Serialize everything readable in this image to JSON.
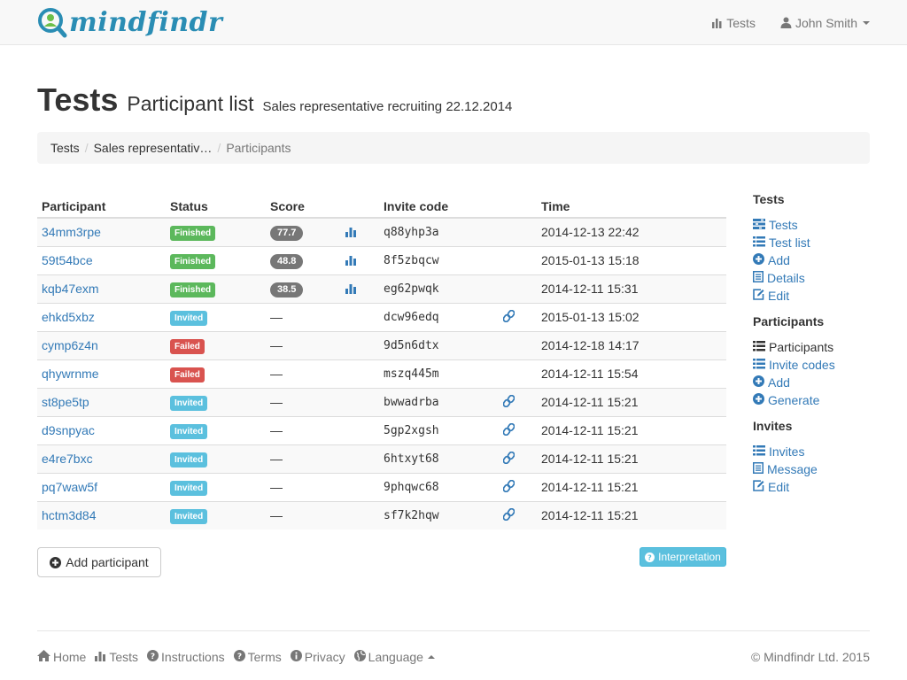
{
  "app": {
    "logo_text": "mindfindr"
  },
  "navbar": {
    "tests_label": "Tests",
    "user_label": "John Smith"
  },
  "header": {
    "title": "Tests",
    "subtitle": "Participant list",
    "context": "Sales representative recruiting 22.12.2014"
  },
  "breadcrumb": {
    "items": [
      "Tests",
      "Sales representativ…",
      "Participants"
    ]
  },
  "table": {
    "headers": [
      "Participant",
      "Status",
      "Score",
      "Invite code",
      "Time"
    ],
    "rows": [
      {
        "participant": "34mm3rpe",
        "status": "Finished",
        "score": "77.7",
        "invite_code": "q88yhp3a",
        "time": "2014-12-13 22:42"
      },
      {
        "participant": "59t54bce",
        "status": "Finished",
        "score": "48.8",
        "invite_code": "8f5zbqcw",
        "time": "2015-01-13 15:18"
      },
      {
        "participant": "kqb47exm",
        "status": "Finished",
        "score": "38.5",
        "invite_code": "eg62pwqk",
        "time": "2014-12-11 15:31"
      },
      {
        "participant": "ehkd5xbz",
        "status": "Invited",
        "score": "—",
        "invite_code": "dcw96edq",
        "time": "2015-01-13 15:02"
      },
      {
        "participant": "cymp6z4n",
        "status": "Failed",
        "score": "—",
        "invite_code": "9d5n6dtx",
        "time": "2014-12-18 14:17"
      },
      {
        "participant": "qhywrnme",
        "status": "Failed",
        "score": "—",
        "invite_code": "mszq445m",
        "time": "2014-12-11 15:54"
      },
      {
        "participant": "st8pe5tp",
        "status": "Invited",
        "score": "—",
        "invite_code": "bwwadrba",
        "time": "2014-12-11 15:21"
      },
      {
        "participant": "d9snpyac",
        "status": "Invited",
        "score": "—",
        "invite_code": "5gp2xgsh",
        "time": "2014-12-11 15:21"
      },
      {
        "participant": "e4re7bxc",
        "status": "Invited",
        "score": "—",
        "invite_code": "6htxyt68",
        "time": "2014-12-11 15:21"
      },
      {
        "participant": "pq7waw5f",
        "status": "Invited",
        "score": "—",
        "invite_code": "9phqwc68",
        "time": "2014-12-11 15:21"
      },
      {
        "participant": "hctm3d84",
        "status": "Invited",
        "score": "—",
        "invite_code": "sf7k2hqw",
        "time": "2014-12-11 15:21"
      }
    ]
  },
  "status_colors": {
    "Finished": "#5cb85c",
    "Invited": "#5bc0de",
    "Failed": "#d9534f"
  },
  "buttons": {
    "add_participant": "Add participant",
    "interpretation": "Interpretation"
  },
  "sidebar": {
    "groups": [
      {
        "title": "Tests",
        "items": [
          {
            "label": "Tests",
            "icon": "tasks-icon"
          },
          {
            "label": "Test list",
            "icon": "list-icon"
          },
          {
            "label": "Add",
            "icon": "plus-circle-icon"
          },
          {
            "label": "Details",
            "icon": "document-icon"
          },
          {
            "label": "Edit",
            "icon": "edit-icon"
          }
        ]
      },
      {
        "title": "Participants",
        "items": [
          {
            "label": "Participants",
            "icon": "list-icon",
            "current": true
          },
          {
            "label": "Invite codes",
            "icon": "list-icon"
          },
          {
            "label": "Add",
            "icon": "plus-circle-icon"
          },
          {
            "label": "Generate",
            "icon": "plus-circle-icon"
          }
        ]
      },
      {
        "title": "Invites",
        "items": [
          {
            "label": "Invites",
            "icon": "list-icon"
          },
          {
            "label": "Message",
            "icon": "document-icon"
          },
          {
            "label": "Edit",
            "icon": "edit-icon"
          }
        ]
      }
    ]
  },
  "footer": {
    "links": [
      "Home",
      "Tests",
      "Instructions",
      "Terms",
      "Privacy",
      "Language"
    ],
    "copyright": "© Mindfindr Ltd. 2015"
  }
}
